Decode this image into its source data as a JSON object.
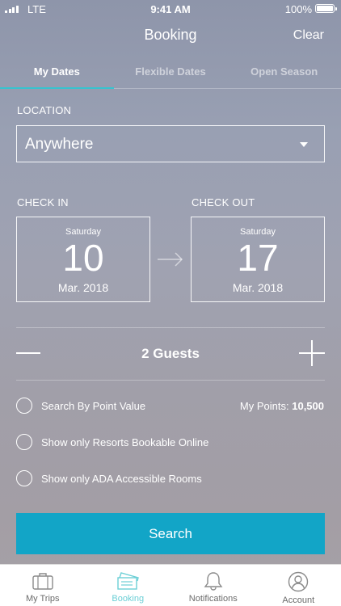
{
  "status_bar": {
    "carrier": "LTE",
    "time": "9:41 AM",
    "battery": "100%"
  },
  "header": {
    "title": "Booking",
    "clear_label": "Clear"
  },
  "tabs": [
    {
      "label": "My Dates",
      "active": true
    },
    {
      "label": "Flexible Dates",
      "active": false
    },
    {
      "label": "Open Season",
      "active": false
    }
  ],
  "location": {
    "label": "LOCATION",
    "value": "Anywhere"
  },
  "check_in": {
    "label": "CHECK IN",
    "weekday": "Saturday",
    "day": "10",
    "month_year": "Mar. 2018"
  },
  "check_out": {
    "label": "CHECK OUT",
    "weekday": "Saturday",
    "day": "17",
    "month_year": "Mar. 2018"
  },
  "guests": {
    "text": "2 Guests"
  },
  "options": [
    {
      "label": "Search By Point Value"
    },
    {
      "label": "Show only Resorts Bookable Online"
    },
    {
      "label": "Show only ADA Accessible Rooms"
    }
  ],
  "points": {
    "label": "My Points:",
    "value": "10,500"
  },
  "search_label": "Search",
  "tabbar": [
    {
      "label": "My Trips",
      "icon": "suitcase-icon",
      "active": false
    },
    {
      "label": "Booking",
      "icon": "tickets-icon",
      "active": true
    },
    {
      "label": "Notifications",
      "icon": "bell-icon",
      "active": false
    },
    {
      "label": "Account",
      "icon": "user-icon",
      "active": false
    }
  ],
  "colors": {
    "accent": "#36c3cf",
    "button": "#12a5c7",
    "active_tab_icon": "#6ccfd6"
  }
}
